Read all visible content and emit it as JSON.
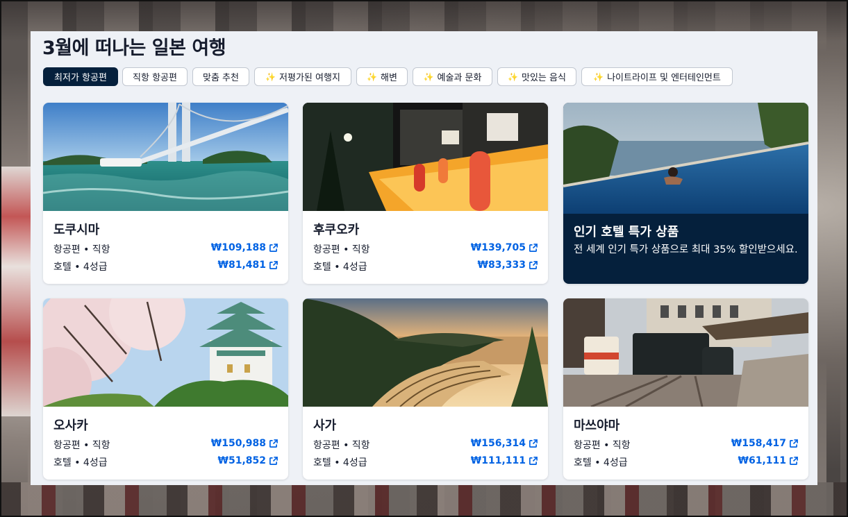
{
  "title": "3월에 떠나는 일본 여행",
  "chips": [
    {
      "label": "최저가 항공편",
      "sparkle": false,
      "active": true
    },
    {
      "label": "직항 항공편",
      "sparkle": false,
      "active": false
    },
    {
      "label": "맞춤 추천",
      "sparkle": false,
      "active": false
    },
    {
      "label": "저평가된 여행지",
      "sparkle": true,
      "active": false
    },
    {
      "label": "해변",
      "sparkle": true,
      "active": false
    },
    {
      "label": "예술과 문화",
      "sparkle": true,
      "active": false
    },
    {
      "label": "맛있는 음식",
      "sparkle": true,
      "active": false
    },
    {
      "label": "나이트라이프 및 엔터테인먼트",
      "sparkle": true,
      "active": false
    }
  ],
  "sparkle_glyph": "✨",
  "cards": [
    {
      "name": "도쿠시마",
      "flight_label": "항공편 • 직항",
      "flight_price": "₩109,188",
      "hotel_label": "호텔 • 4성급",
      "hotel_price": "₩81,481",
      "image": "bridge-over-whirlpool-sea"
    },
    {
      "name": "후쿠오카",
      "flight_label": "항공편 • 직항",
      "flight_price": "₩139,705",
      "hotel_label": "호텔 • 4성급",
      "hotel_price": "₩83,333",
      "image": "night-street-food-stalls"
    },
    {
      "name": "오사카",
      "flight_label": "항공편 • 직항",
      "flight_price": "₩150,988",
      "hotel_label": "호텔 • 4성급",
      "hotel_price": "₩51,852",
      "image": "castle-with-cherry-blossoms"
    },
    {
      "name": "사가",
      "flight_label": "항공편 • 직항",
      "flight_price": "₩156,314",
      "hotel_label": "호텔 • 4성급",
      "hotel_price": "₩111,111",
      "image": "terraced-rice-fields-sunset"
    },
    {
      "name": "마쓰야마",
      "flight_label": "항공편 • 직항",
      "flight_price": "₩158,417",
      "hotel_label": "호텔 • 4성급",
      "hotel_price": "₩61,111",
      "image": "steam-tram-station"
    }
  ],
  "promo": {
    "title": "인기 호텔 특가 상품",
    "description": "전 세계 인기 특가 상품으로 최대 35% 할인받으세요.",
    "image": "infinity-pool-swimmer"
  },
  "colors": {
    "accent": "#0062e3",
    "navy": "#05203c",
    "panel": "#eef1f6"
  },
  "icons": {
    "external_link": "external-link-icon",
    "sparkle": "sparkle-icon"
  }
}
